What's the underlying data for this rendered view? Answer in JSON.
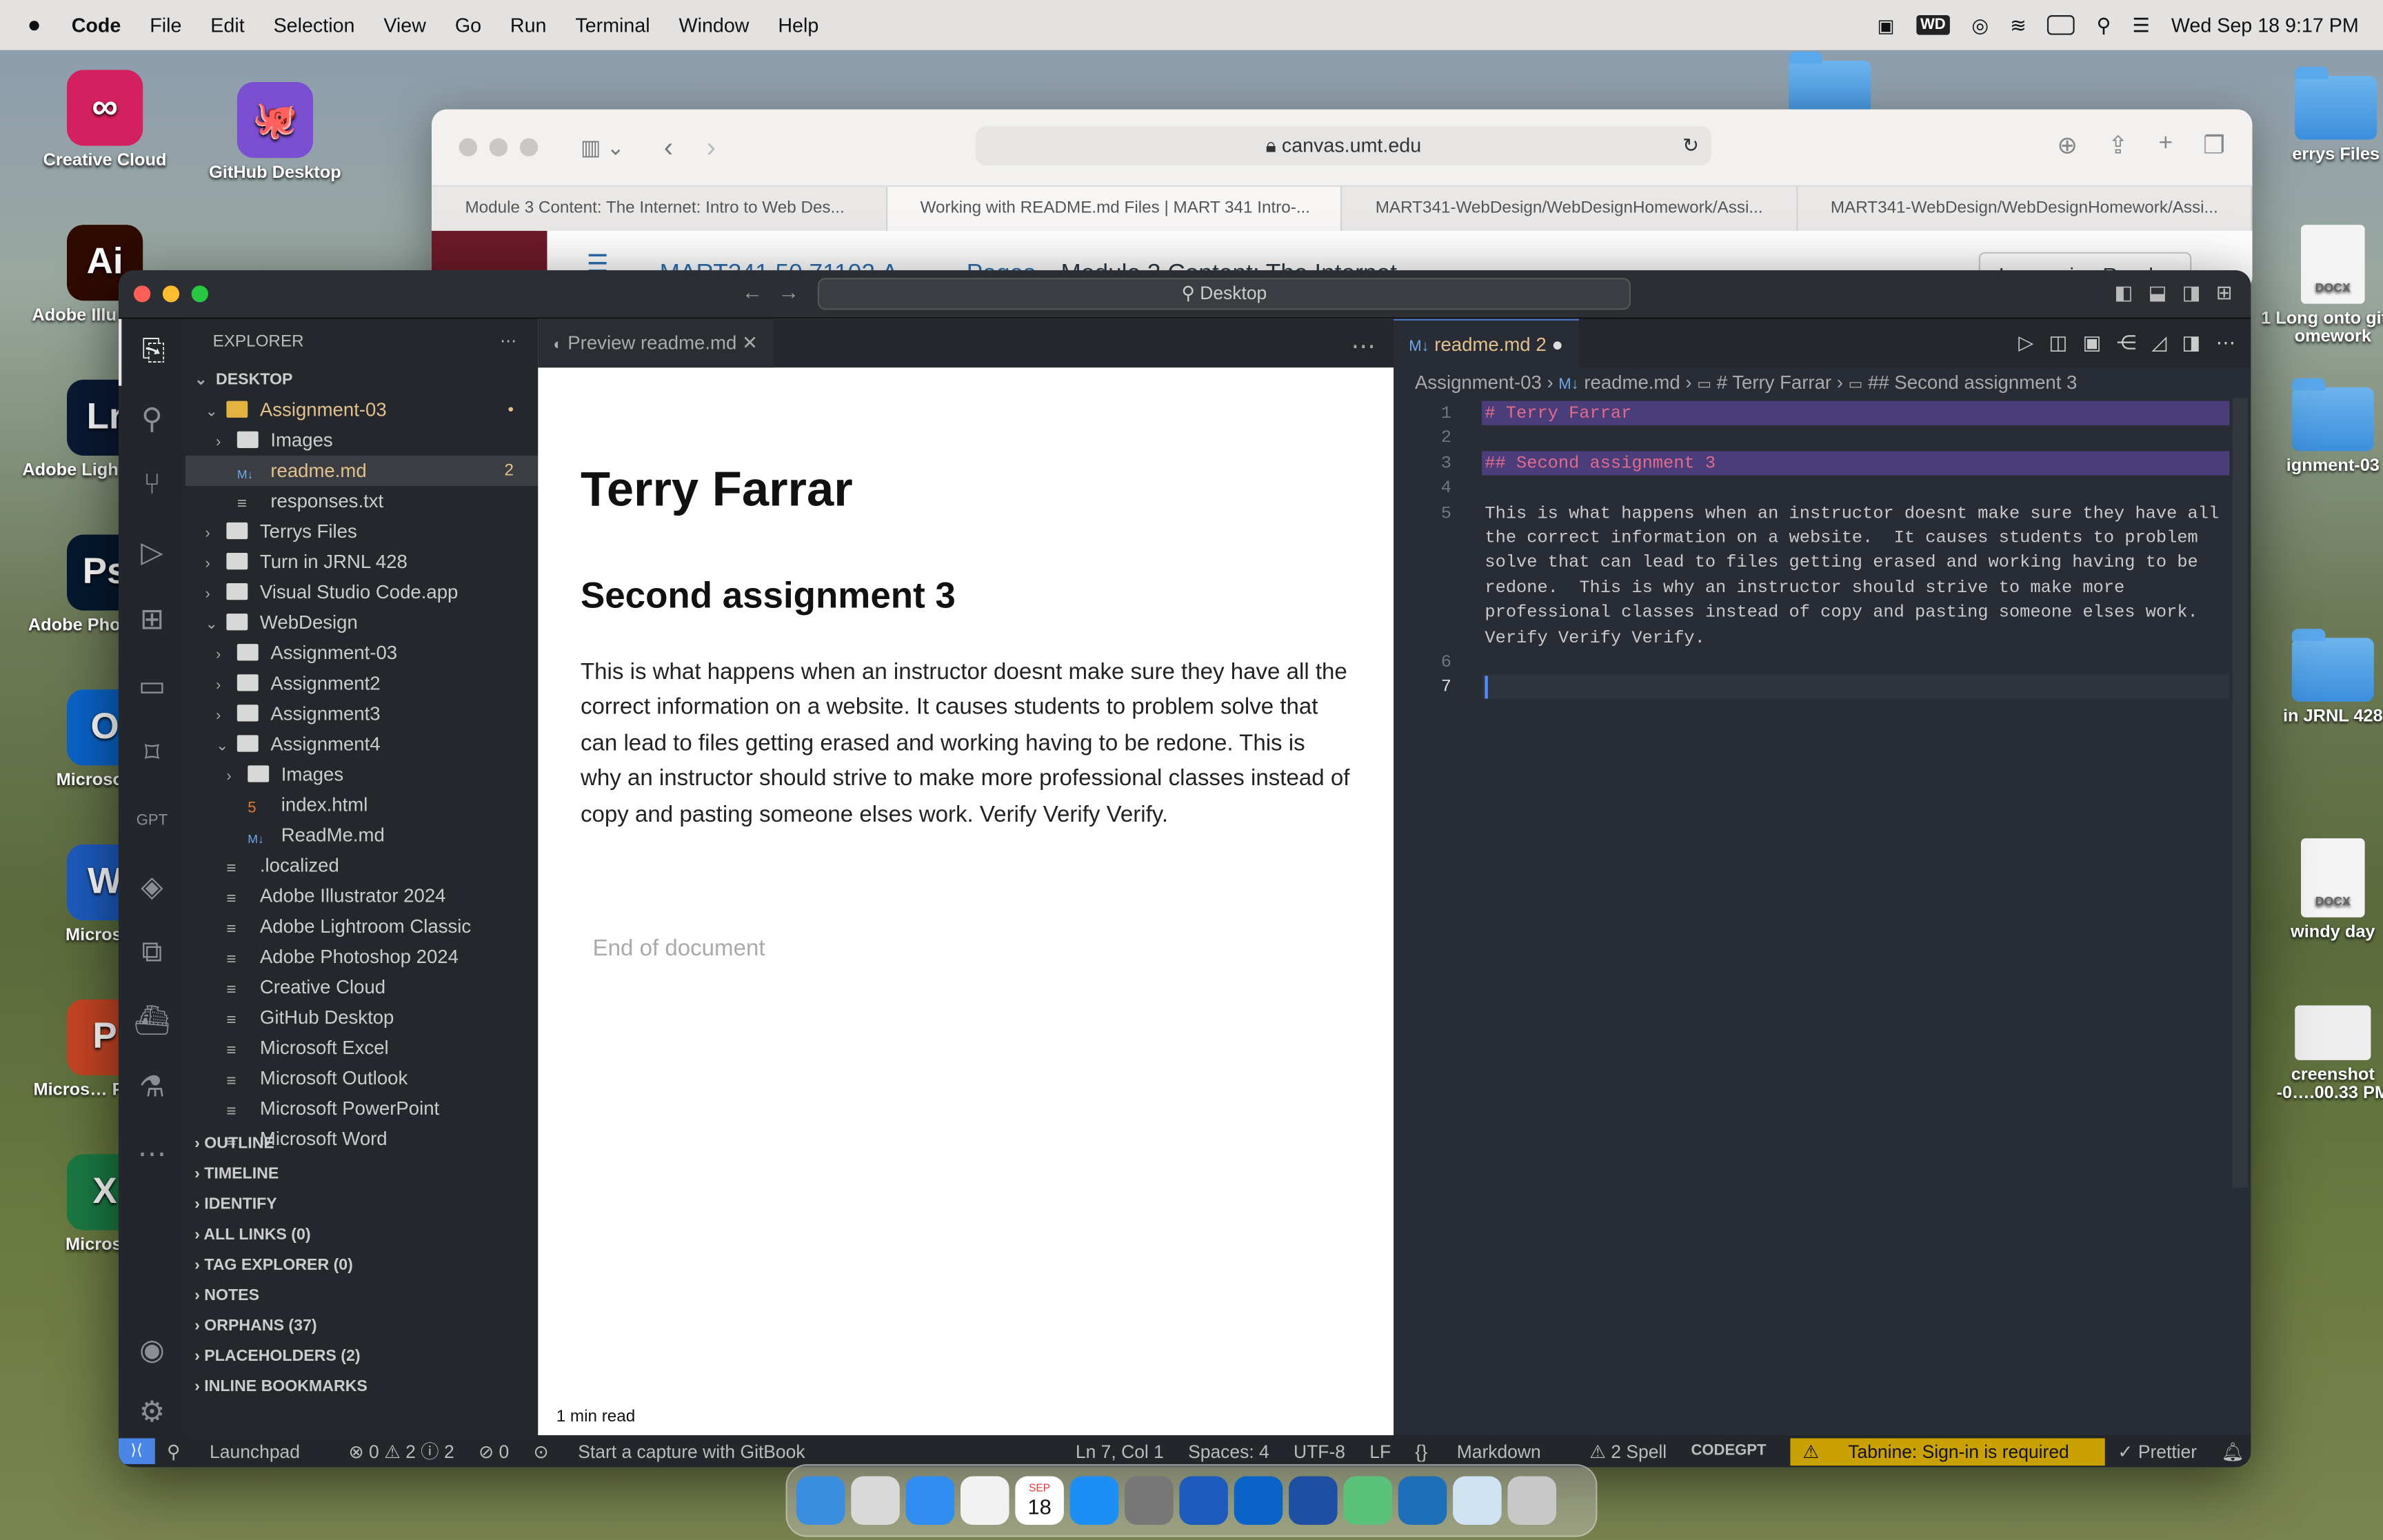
{
  "menubar": {
    "app": "Code",
    "items": [
      "File",
      "Edit",
      "Selection",
      "View",
      "Go",
      "Run",
      "Terminal",
      "Window",
      "Help"
    ],
    "clock": "Wed Sep 18  9:17 PM"
  },
  "desktop_left": [
    {
      "label": "Creative Cloud",
      "color": "#d4205e",
      "glyph": "∞"
    },
    {
      "label": "GitHub Desktop",
      "color": "#7b4fd1",
      "glyph": "🐙"
    },
    {
      "label": "Adobe Illu… 2024",
      "color": "#2e0a00",
      "glyph": "Ai"
    },
    {
      "label": "Adobe Ligh… Class",
      "color": "#0a1a33",
      "glyph": "Lr"
    },
    {
      "label": "Adobe Pho… 2024",
      "color": "#04192e",
      "glyph": "Ps"
    },
    {
      "label": "Microsoft O",
      "color": "#0a64c8",
      "glyph": "O"
    },
    {
      "label": "Microsoft",
      "color": "#1d5bbf",
      "glyph": "W"
    },
    {
      "label": "Micros… PowerP",
      "color": "#c64524",
      "glyph": "P"
    },
    {
      "label": "Microsoft",
      "color": "#1a7a43",
      "glyph": "X"
    }
  ],
  "desktop_right": [
    "errys Files",
    "DOCX",
    "1 Long onto git…omework",
    "ignment-03",
    "in JRNL 428",
    "DOCX",
    "windy day",
    "creenshot -0….00.33 PM"
  ],
  "safari": {
    "url": "canvas.umt.edu",
    "tabs": [
      "Module 3 Content: The Internet: Intro to Web Des...",
      "Working with README.md Files | MART 341 Intro-...",
      "MART341-WebDesign/WebDesignHomework/Assi...",
      "MART341-WebDesign/WebDesignHomework/Assi..."
    ],
    "course": "MART341.50.71102.A",
    "crumb_pages": "Pages",
    "crumb_current": "Module 3 Content: The Internet",
    "immersive": "Immersive Reader"
  },
  "vscode": {
    "command_center": "Desktop",
    "explorer_title": "EXPLORER",
    "root": "DESKTOP",
    "tree": [
      {
        "d": 1,
        "t": "folder",
        "open": true,
        "name": "Assignment-03",
        "mod": "•",
        "hl": true
      },
      {
        "d": 2,
        "t": "folder",
        "open": false,
        "name": "Images"
      },
      {
        "d": 2,
        "t": "md",
        "name": "readme.md",
        "badge": "2",
        "sel": true,
        "hl": true
      },
      {
        "d": 2,
        "t": "file",
        "name": "responses.txt"
      },
      {
        "d": 1,
        "t": "folder",
        "open": false,
        "name": "Terrys Files"
      },
      {
        "d": 1,
        "t": "folder",
        "open": false,
        "name": "Turn in JRNL 428"
      },
      {
        "d": 1,
        "t": "folder",
        "open": false,
        "name": "Visual Studio Code.app"
      },
      {
        "d": 1,
        "t": "folder",
        "open": true,
        "name": "WebDesign"
      },
      {
        "d": 2,
        "t": "folder",
        "open": false,
        "name": "Assignment-03"
      },
      {
        "d": 2,
        "t": "folder",
        "open": false,
        "name": "Assignment2"
      },
      {
        "d": 2,
        "t": "folder",
        "open": false,
        "name": "Assignment3"
      },
      {
        "d": 2,
        "t": "folder",
        "open": true,
        "name": "Assignment4"
      },
      {
        "d": 3,
        "t": "folder",
        "open": false,
        "name": "Images"
      },
      {
        "d": 3,
        "t": "html",
        "name": "index.html"
      },
      {
        "d": 3,
        "t": "md",
        "name": "ReadMe.md"
      },
      {
        "d": 1,
        "t": "file",
        "name": ".localized"
      },
      {
        "d": 1,
        "t": "file",
        "name": "Adobe Illustrator 2024"
      },
      {
        "d": 1,
        "t": "file",
        "name": "Adobe Lightroom Classic"
      },
      {
        "d": 1,
        "t": "file",
        "name": "Adobe Photoshop 2024"
      },
      {
        "d": 1,
        "t": "file",
        "name": "Creative Cloud"
      },
      {
        "d": 1,
        "t": "file",
        "name": "GitHub Desktop"
      },
      {
        "d": 1,
        "t": "file",
        "name": "Microsoft Excel"
      },
      {
        "d": 1,
        "t": "file",
        "name": "Microsoft Outlook"
      },
      {
        "d": 1,
        "t": "file",
        "name": "Microsoft PowerPoint"
      },
      {
        "d": 1,
        "t": "file",
        "name": "Microsoft Word"
      }
    ],
    "sections": [
      "OUTLINE",
      "TIMELINE",
      "IDENTIFY",
      "ALL LINKS (0)",
      "TAG EXPLORER (0)",
      "NOTES",
      "ORPHANS (37)",
      "PLACEHOLDERS (2)",
      "INLINE BOOKMARKS"
    ],
    "preview_tab": "Preview readme.md",
    "preview": {
      "h1": "Terry Farrar",
      "h2": "Second assignment 3",
      "p": "This is what happens when an instructor doesnt make sure they have all the correct information on a website. It causes students to problem solve that can lead to files getting erased and working having to be redone. This is why an instructor should strive to make more professional classes instead of copy and pasting someone elses work. Verify Verify Verify.",
      "end": "End of document",
      "read": "1 min read"
    },
    "editor_tab": "readme.md",
    "editor_tab_badge": "2",
    "breadcrumb": [
      "Assignment-03",
      "readme.md",
      "# Terry Farrar",
      "## Second assignment 3"
    ],
    "lines": [
      {
        "n": "1",
        "text": "# Terry Farrar",
        "hl": true
      },
      {
        "n": "2",
        "text": ""
      },
      {
        "n": "3",
        "text": "## Second assignment 3",
        "hl": true
      },
      {
        "n": "4",
        "text": ""
      },
      {
        "n": "5",
        "text": "This is what happens when an instructor doesnt make sure they have all"
      },
      {
        "n": "",
        "text": "the correct information on a website.  It causes students to problem"
      },
      {
        "n": "",
        "text": "solve that can lead to files getting erased and working having to be"
      },
      {
        "n": "",
        "text": "redone.  This is why an instructor should strive to make more"
      },
      {
        "n": "",
        "text": "professional classes instead of copy and pasting someone elses work."
      },
      {
        "n": "",
        "text": "Verify Verify Verify."
      },
      {
        "n": "6",
        "text": ""
      },
      {
        "n": "7",
        "text": "",
        "cur": true
      }
    ],
    "status": {
      "remote": "⟩⟨",
      "launchpad": "Launchpad",
      "problems": "⊗ 0 ⚠ 2 ⓘ 2",
      "ports": "⊘ 0",
      "gitbook": "Start a capture with GitBook",
      "position": "Ln 7, Col 1",
      "spaces": "Spaces: 4",
      "encoding": "UTF-8",
      "eol": "LF",
      "lang": "Markdown",
      "spell": "⚠ 2 Spell",
      "codegpt": "CODEGPT",
      "tabnine": "Tabnine: Sign-in is required",
      "prettier": "✓ Prettier"
    }
  },
  "dock": [
    "Finder",
    "Launchpad",
    "Safari",
    "Chrome",
    "Calendar",
    "App Store",
    "Settings",
    "Word",
    "Outlook",
    "WD",
    "Atom",
    "VS Code",
    "Preview",
    "Trash"
  ],
  "dock_calendar_month": "SEP",
  "dock_calendar_day": "18"
}
